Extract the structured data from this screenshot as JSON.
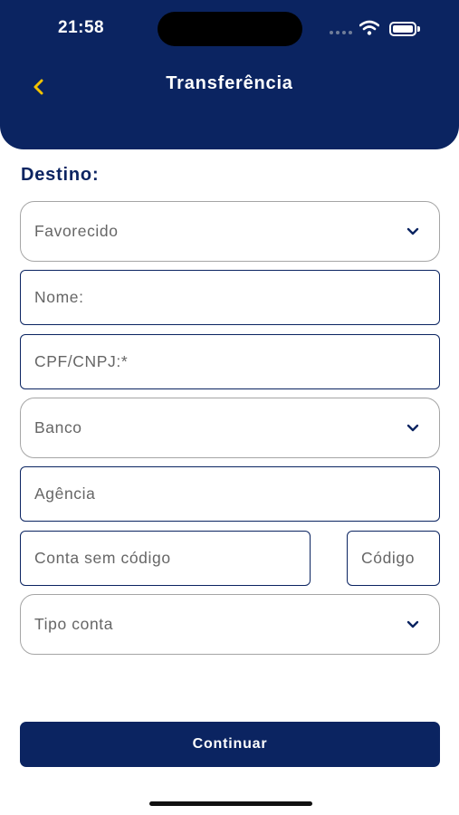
{
  "status_bar": {
    "time": "21:58",
    "icons": [
      "signal-icon",
      "wifi-icon",
      "battery-icon"
    ]
  },
  "header": {
    "title": "Transferência",
    "back_icon": "chevron-left-icon",
    "background_color": "#0b2461",
    "back_icon_color": "#f2c200"
  },
  "form": {
    "section_label": "Destino:",
    "fields": {
      "favorecido": {
        "placeholder": "Favorecido",
        "type": "select"
      },
      "nome": {
        "placeholder": "Nome:",
        "type": "text"
      },
      "cpf_cnpj": {
        "placeholder": "CPF/CNPJ:*",
        "type": "text"
      },
      "banco": {
        "placeholder": "Banco",
        "type": "select"
      },
      "agencia": {
        "placeholder": "Agência",
        "type": "text"
      },
      "conta": {
        "placeholder": "Conta sem código",
        "type": "text"
      },
      "codigo": {
        "placeholder": "Código",
        "type": "text"
      },
      "tipo_conta": {
        "placeholder": "Tipo conta",
        "type": "select"
      }
    }
  },
  "actions": {
    "continue_label": "Continuar"
  }
}
